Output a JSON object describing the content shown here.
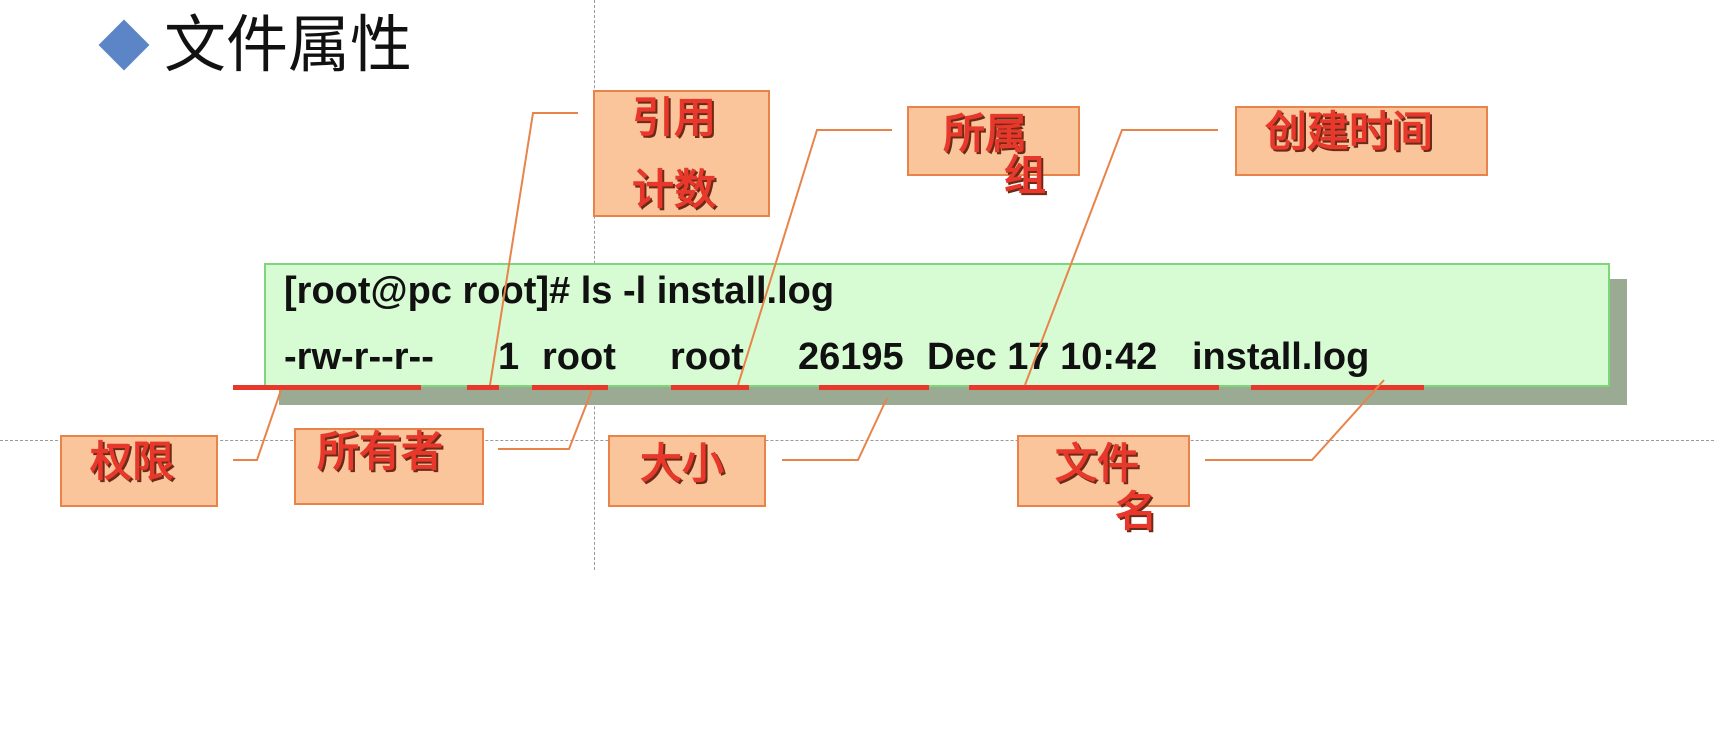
{
  "title": "文件属性",
  "terminal": {
    "command": "[root@pc root]# ls -l install.log",
    "output": {
      "permissions": "-rw-r--r--",
      "links": "1",
      "owner": "root",
      "group": "root",
      "size": "26195",
      "date": "Dec 17 10:42",
      "filename": "install.log"
    }
  },
  "labels": {
    "permissions": "权限",
    "ref_count_1": "引用",
    "ref_count_2": "计数",
    "owner": "所有者",
    "group_1": "所属",
    "group_2": "组",
    "size": "大小",
    "created_time": "创建时间",
    "filename_1": "文件",
    "filename_2": "名"
  },
  "colors": {
    "label_text": "#e8382b",
    "label_box": "#fbc59b",
    "label_border": "#e8834a",
    "leader_line": "#e8834a",
    "underline": "#e8382b",
    "terminal_bg": "#d7fcd4",
    "terminal_border": "#7ed67a",
    "bullet": "#5b85c6"
  }
}
